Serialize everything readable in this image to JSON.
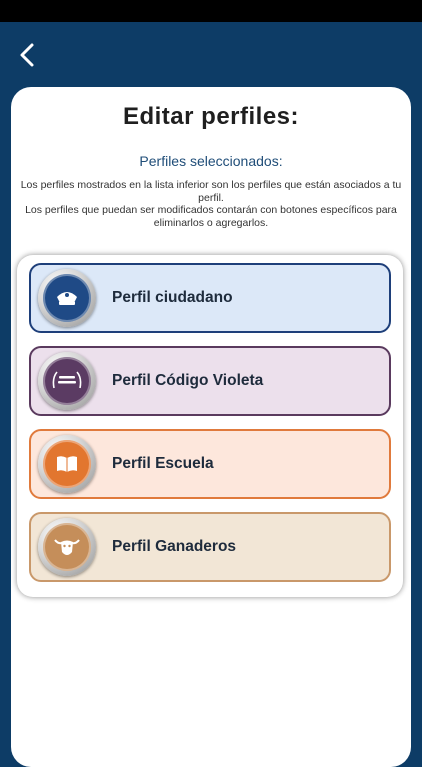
{
  "header": {
    "back_icon": "chevron-left-icon"
  },
  "card": {
    "title": "Editar perfiles:",
    "subtitle": "Perfiles seleccionados:",
    "description_1": "Los perfiles mostrados en la lista inferior son los perfiles que están asociados a tu perfil.",
    "description_2": "Los perfiles que puedan ser modificados contarán con botones específicos para eliminarlos o agregarlos."
  },
  "profiles": [
    {
      "label": "Perfil ciudadano",
      "icon": "police-cap-badge-icon",
      "bg": "#dce8f8",
      "border": "#1e3f7a",
      "badge": "#1f4a86"
    },
    {
      "label": "Perfil Código Violeta",
      "icon": "codigo-violeta-badge-icon",
      "bg": "#ece0ec",
      "border": "#5a3a5e",
      "badge": "#5b3b63"
    },
    {
      "label": "Perfil Escuela",
      "icon": "book-badge-icon",
      "bg": "#fde7dc",
      "border": "#e07a3c",
      "badge": "#e2762f"
    },
    {
      "label": "Perfil Ganaderos",
      "icon": "cow-head-badge-icon",
      "bg": "#f2e6d6",
      "border": "#c9986a",
      "badge": "#c58e5a"
    }
  ]
}
